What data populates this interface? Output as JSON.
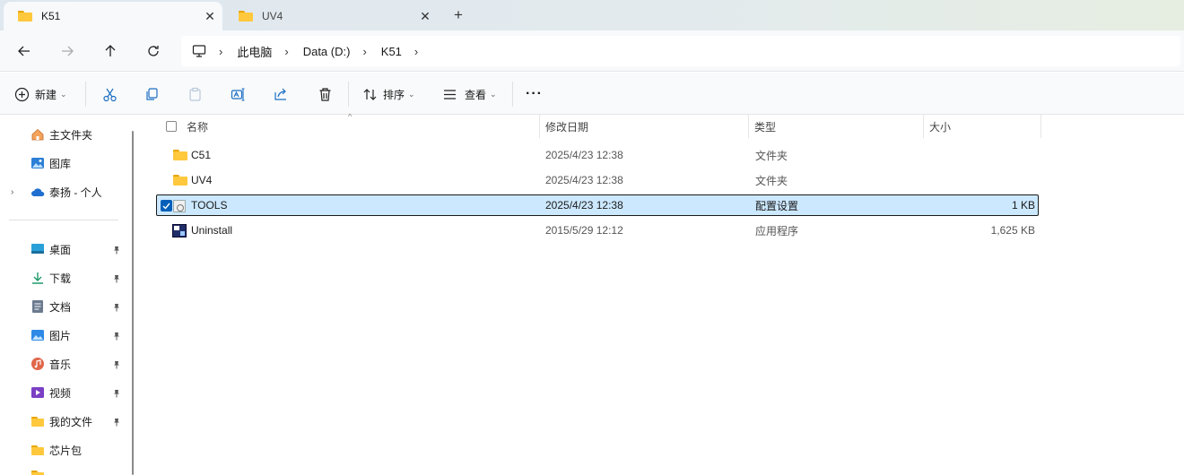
{
  "tabs": [
    {
      "label": "K51",
      "active": true
    },
    {
      "label": "UV4",
      "active": false
    }
  ],
  "address": {
    "crumbs": [
      "此电脑",
      "Data (D:)",
      "K51"
    ]
  },
  "commands": {
    "new_label": "新建",
    "sort_label": "排序",
    "view_label": "查看",
    "more_label": "···"
  },
  "sidebar": {
    "quick": [
      {
        "label": "主文件夹",
        "icon": "home-icon"
      },
      {
        "label": "图库",
        "icon": "gallery-icon"
      },
      {
        "label": "泰扬 - 个人",
        "icon": "onedrive-icon"
      }
    ],
    "pinned": [
      {
        "label": "桌面",
        "icon": "desktop-icon"
      },
      {
        "label": "下载",
        "icon": "download-icon"
      },
      {
        "label": "文档",
        "icon": "documents-icon"
      },
      {
        "label": "图片",
        "icon": "pictures-icon"
      },
      {
        "label": "音乐",
        "icon": "music-icon"
      },
      {
        "label": "视频",
        "icon": "videos-icon"
      },
      {
        "label": "我的文件",
        "icon": "folder-icon"
      },
      {
        "label": "芯片包",
        "icon": "folder-icon"
      }
    ]
  },
  "columns": {
    "name": "名称",
    "date": "修改日期",
    "type": "类型",
    "size": "大小"
  },
  "files": [
    {
      "name": "C51",
      "date": "2025/4/23 12:38",
      "type": "文件夹",
      "size": "",
      "icon": "folder-icon",
      "selected": false
    },
    {
      "name": "UV4",
      "date": "2025/4/23 12:38",
      "type": "文件夹",
      "size": "",
      "icon": "folder-icon",
      "selected": false
    },
    {
      "name": "TOOLS",
      "date": "2025/4/23 12:38",
      "type": "配置设置",
      "size": "1 KB",
      "icon": "config-file-icon",
      "selected": true
    },
    {
      "name": "Uninstall",
      "date": "2015/5/29 12:12",
      "type": "应用程序",
      "size": "1,625 KB",
      "icon": "app-icon",
      "selected": false
    }
  ]
}
